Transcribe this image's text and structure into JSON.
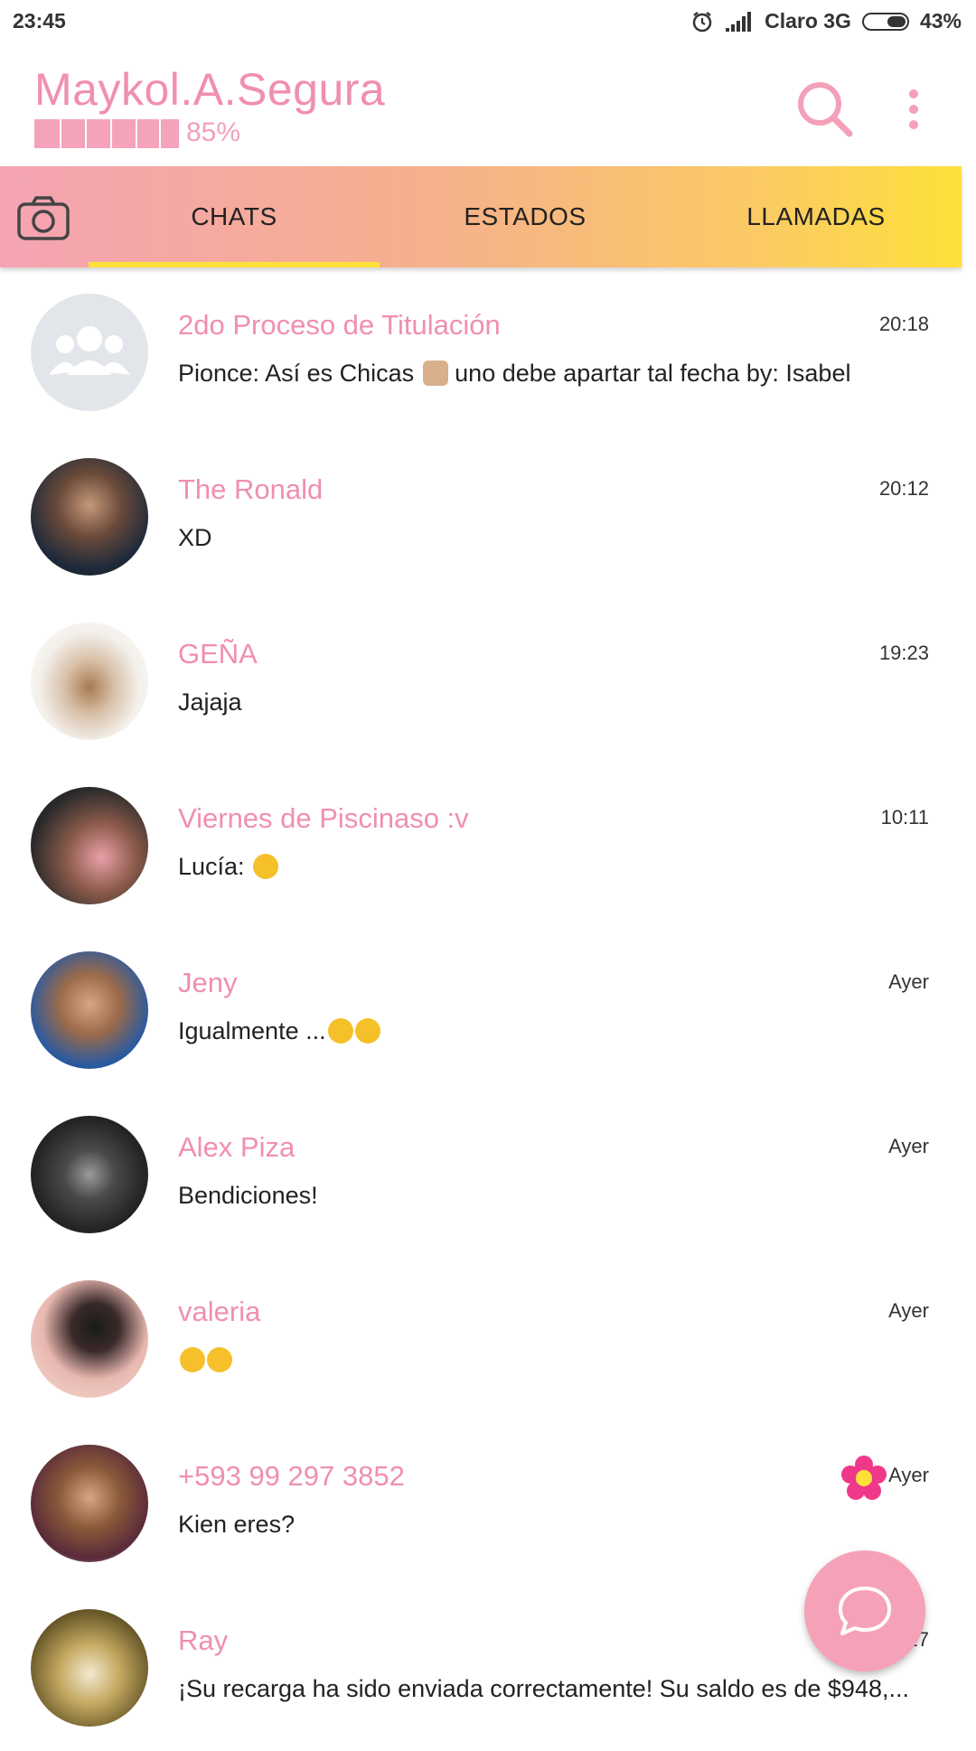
{
  "status_bar": {
    "time": "23:45",
    "carrier": "Claro 3G",
    "battery": "43%",
    "icons": [
      "alarm-icon",
      "signal-icon",
      "battery-icon"
    ]
  },
  "header": {
    "profile_name": "Maykol.A.Segura",
    "progress_text": "85%",
    "progress_value": 0.85,
    "icons": [
      "search-icon",
      "more-vert-icon"
    ]
  },
  "tabs": {
    "items": [
      "CHATS",
      "ESTADOS",
      "LLAMADAS"
    ],
    "selected": "CHATS",
    "camera_icon": "camera-icon"
  },
  "chats": [
    {
      "name": "2do Proceso de Titulación",
      "time": "20:18",
      "message": "Pionce: Así es Chicas",
      "message_suffix": " uno debe apartar tal fecha by: Isabel",
      "avatar": "group-avatar-icon"
    },
    {
      "name": "The Ronald",
      "time": "20:12",
      "message": "XD"
    },
    {
      "name": "GEÑA",
      "time": "19:23",
      "message": "Jajaja"
    },
    {
      "name": "Viernes de Piscinaso :v",
      "time": "10:11",
      "message": "Lucía:"
    },
    {
      "name": "Jeny",
      "time": "Ayer",
      "message": "Igualmente ..."
    },
    {
      "name": "Alex Piza",
      "time": "Ayer",
      "message": "Bendiciones!"
    },
    {
      "name": "valeria",
      "time": "Ayer",
      "message": ""
    },
    {
      "name": "+593 99 297 3852",
      "time": "Ayer",
      "message": "Kien eres?",
      "badge_icon": "flower-icon"
    },
    {
      "name": "Ray",
      "time": "17",
      "message": "¡Su recarga ha sido enviada correctamente! Su saldo es de $948,..."
    }
  ],
  "fab": {
    "icon": "chat-bubble-icon"
  },
  "colors": {
    "accent_pink": "#f08fae",
    "tab_gradient_start": "#f5a3b3",
    "tab_gradient_end": "#fde13a",
    "indicator": "#fde13a",
    "fab": "#f5a2b8"
  }
}
